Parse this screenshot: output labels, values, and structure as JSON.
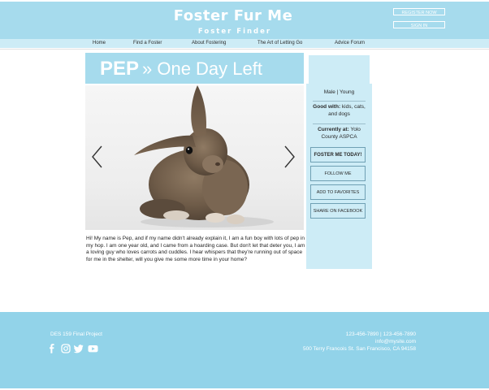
{
  "site": {
    "title": "Foster Fur Me",
    "subtitle": "Foster Finder",
    "register_label": "REGISTER NOW",
    "signin_label": "SIGN IN"
  },
  "nav": {
    "items": [
      {
        "label": "Home"
      },
      {
        "label": "Find a Foster"
      },
      {
        "label": "About Fostering"
      },
      {
        "label": "The Art of Letting Go"
      },
      {
        "label": "Advice Forum"
      }
    ]
  },
  "pet": {
    "name": "PEP",
    "status": "» One Day Left",
    "sex": "Male",
    "separator": "|",
    "age": "Young",
    "good_with_label": "Good with:",
    "good_with_value": "kids, cats, and dogs",
    "currently_at_label": "Currently at:",
    "currently_at_value": "Yolo County ASPCA",
    "description": "Hi! My name is Pep, and if my name didn't already explain it, I am a fun boy with lots of pep in my hop. I am one year old, and I came from a hoarding case. But don't let that deter you, I am a loving guy who loves carrots and cuddles. I hear whispers that they're running out of space for me in the shelter, will you give me some more time in your home?"
  },
  "actions": {
    "foster_label": "FOSTER ME TODAY!",
    "follow_label": "FOLLOW ME",
    "favorites_label": "ADD TO FAVORITES",
    "share_label": "SHARE ON FACEBOOK"
  },
  "footer": {
    "project": "DES 159 Final Project",
    "phone": "123-456-7890 | 123-456-7890",
    "email": "info@mysite.com",
    "address": "500 Terry Francois St. San Francisco, CA 94158",
    "socials": [
      "facebook-icon",
      "instagram-icon",
      "twitter-icon",
      "youtube-icon"
    ]
  },
  "colors": {
    "header": "#a6dbed",
    "nav": "#cdecf6",
    "panel": "#cdecf6",
    "footer": "#92d3e9",
    "text": "#2b2b2b"
  }
}
